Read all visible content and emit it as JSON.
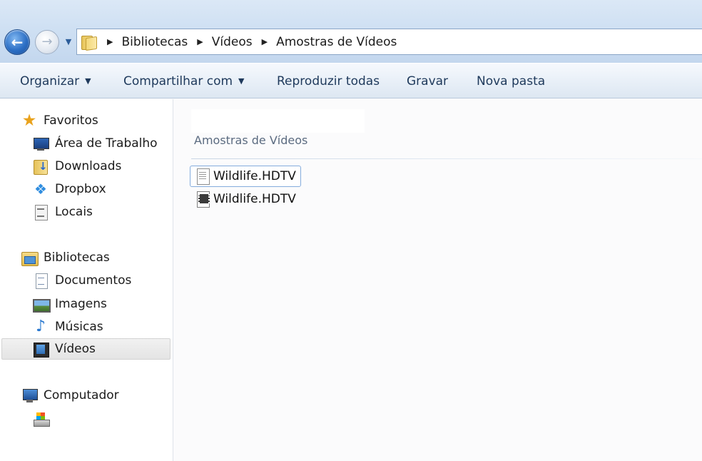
{
  "address": {
    "breadcrumbs": [
      "Bibliotecas",
      "Vídeos",
      "Amostras de Vídeos"
    ]
  },
  "toolbar": {
    "organize": "Organizar",
    "share": "Compartilhar com",
    "play_all": "Reproduzir todas",
    "burn": "Gravar",
    "new_folder": "Nova pasta"
  },
  "navigation": {
    "favorites": {
      "header": "Favoritos",
      "items": [
        "Área de Trabalho",
        "Downloads",
        "Dropbox",
        "Locais"
      ]
    },
    "libraries": {
      "header": "Bibliotecas",
      "items": [
        "Documentos",
        "Imagens",
        "Músicas",
        "Vídeos"
      ],
      "selected": "Vídeos"
    },
    "computer": {
      "header": "Computador"
    }
  },
  "content": {
    "group_header": "Amostras de Vídeos",
    "files": [
      {
        "name": "Wildlife.HDTV",
        "icon": "text-file-icon"
      },
      {
        "name": "Wildlife.HDTV",
        "icon": "video-file-icon"
      }
    ]
  }
}
